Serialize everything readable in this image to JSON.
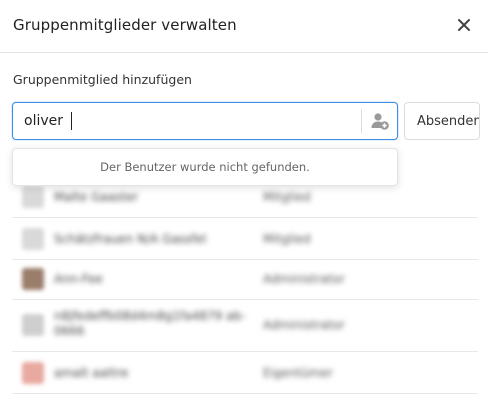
{
  "dialog": {
    "title": "Gruppenmitglieder verwalten"
  },
  "add_member": {
    "label": "Gruppenmitglied hinzufügen",
    "input_value": "oliver",
    "submit_label": "Absenden",
    "add_icon": "add-user-icon"
  },
  "dropdown": {
    "message": "Der Benutzer wurde nicht gefunden."
  },
  "members": [
    {
      "name": "Malte Gaaster",
      "role": "Mitglied",
      "avatar_color": "#d9d9d9"
    },
    {
      "name": "Schätzfrauen N/A Gassfel",
      "role": "Mitglied",
      "avatar_color": "#d9d9d9"
    },
    {
      "name": "Ann-Fee",
      "role": "Administrator",
      "avatar_color": "#9a7d6b"
    },
    {
      "name": "n8jfedeffb08d4m8g1fa4879 ab-0666",
      "role": "Administrator",
      "avatar_color": "#cfcfcf"
    },
    {
      "name": "amalt aattre",
      "role": "Eigentümer",
      "avatar_color": "#e8a9a0"
    }
  ],
  "colors": {
    "accent": "#3a8ee6",
    "border": "#e5e5e5"
  }
}
